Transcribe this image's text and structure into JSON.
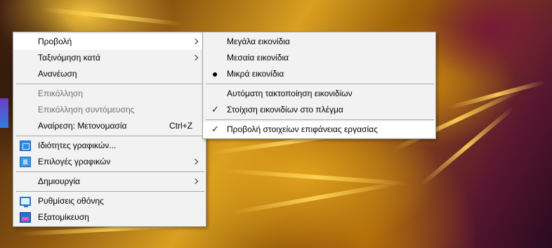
{
  "main_menu": {
    "items": [
      {
        "label": "Προβολή",
        "submenu": true,
        "highlighted": true
      },
      {
        "label": "Ταξινόμηση κατά",
        "submenu": true
      },
      {
        "label": "Ανανέωση"
      },
      {
        "label": "Επικόλληση",
        "disabled": true
      },
      {
        "label": "Επικόλληση συντόμευσης",
        "disabled": true
      },
      {
        "label": "Αναίρεση: Μετονομασία",
        "accelerator": "Ctrl+Z"
      },
      {
        "label": "Ιδιότητες γραφικών...",
        "icon": "graphics-properties-icon"
      },
      {
        "label": "Επιλογές γραφικών",
        "icon": "graphics-options-icon",
        "submenu": true
      },
      {
        "label": "Δημιουργία",
        "submenu": true
      },
      {
        "label": "Ρυθμίσεις οθόνης",
        "icon": "display-settings-icon"
      },
      {
        "label": "Εξατομίκευση",
        "icon": "personalize-icon"
      }
    ]
  },
  "view_submenu": {
    "items": [
      {
        "label": "Μεγάλα εικονίδια"
      },
      {
        "label": "Μεσαία εικονίδια"
      },
      {
        "label": "Μικρά εικονίδια",
        "mark": "bullet"
      },
      {
        "label": "Αυτόματη τακτοποίηση εικονιδίων"
      },
      {
        "label": "Στοίχιση εικονιδίων στο πλέγμα",
        "mark": "check"
      },
      {
        "label": "Προβολή στοιχείων επιφάνειας εργασίας",
        "mark": "check",
        "highlighted": true
      }
    ]
  },
  "colors": {
    "menu_background": "#f2f2f2",
    "menu_highlight": "#ffffff",
    "disabled_text": "#6d6d6d"
  }
}
